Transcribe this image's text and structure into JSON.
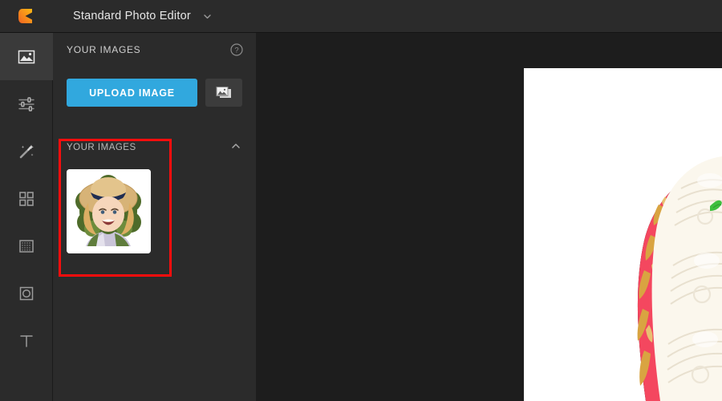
{
  "app": {
    "logo_icon": "cutout-logo-icon",
    "title": "Standard Photo Editor",
    "title_caret_icon": "chevron-down-icon"
  },
  "rail": {
    "items": [
      {
        "icon": "image-icon",
        "name": "rail-item-image",
        "active": true
      },
      {
        "icon": "sliders-icon",
        "name": "rail-item-adjust",
        "active": false
      },
      {
        "icon": "magic-wand-icon",
        "name": "rail-item-effects",
        "active": false
      },
      {
        "icon": "grid-icon",
        "name": "rail-item-collage",
        "active": false
      },
      {
        "icon": "texture-icon",
        "name": "rail-item-texture",
        "active": false
      },
      {
        "icon": "frame-icon",
        "name": "rail-item-shape",
        "active": false
      },
      {
        "icon": "text-icon",
        "name": "rail-item-text",
        "active": false
      }
    ]
  },
  "panel": {
    "header_title": "YOUR IMAGES",
    "help_icon": "question-mark-icon",
    "upload_label": "UPLOAD IMAGE",
    "gallery_icon": "photo-stack-icon",
    "section": {
      "title": "YOUR IMAGES",
      "collapse_icon": "chevron-up-icon",
      "thumbnail_alt": "girl-in-straw-hat-thumbnail"
    }
  },
  "highlight": {
    "color": "#fc0d0d",
    "target": "your-images-section"
  },
  "canvas": {
    "background_color": "#1d1d1d",
    "image_alt": "white-cream-cake-with-red-and-gold-decoration"
  },
  "colors": {
    "topbar": "#2b2b2b",
    "panel": "#2b2b2b",
    "canvas": "#1d1d1d",
    "accent_blue": "#31a8de",
    "highlight_red": "#fc0d0d",
    "logo_orange": "#f05a22"
  }
}
